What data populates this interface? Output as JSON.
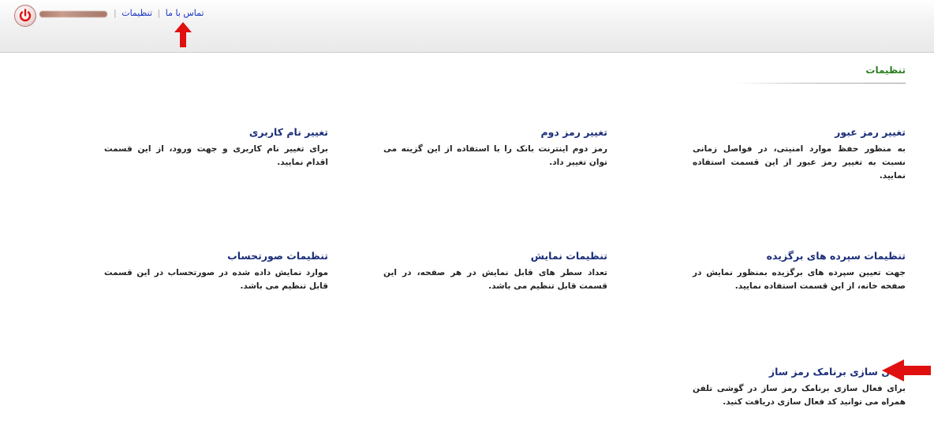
{
  "header": {
    "settings_link": "تنظیمات",
    "separator": "|",
    "contact_link": "تماس با ما",
    "separator2": "|"
  },
  "page": {
    "title": "تنظیمات"
  },
  "cards": [
    {
      "title": "تغییر رمز عبور",
      "desc": "به منظور حفظ موارد امنیتی، در فواصل زمانی نسبت به تغییر رمز عبور از این قسمت استفاده نمایید."
    },
    {
      "title": "تغییر رمز دوم",
      "desc": "رمز دوم اینترنت بانک را با استفاده از این گزینه می توان تغییر داد."
    },
    {
      "title": "تغییر نام کاربری",
      "desc": "برای تغییر نام کاربری و جهت ورود، از این قسمت اقدام نمایید."
    },
    {
      "title": "تنظیمات سپرده های برگزیده",
      "desc": "جهت تعیین سپرده های برگزیده بمنظور نمایش در صفحه خانه، از این قسمت استفاده نمایید."
    },
    {
      "title": "تنظیمات نمایش",
      "desc": "تعداد سطر های قابل نمایش در هر صفحه، در این قسمت قابل تنظیم می باشد."
    },
    {
      "title": "تنظیمات صورتحساب",
      "desc": "موارد نمایش داده شده در صورتحساب در این قسمت قابل تنظیم می باشد."
    },
    {
      "title": "فعال سازی برنامک رمز ساز",
      "desc": "برای فعال سازی برنامک رمز ساز در گوشی تلفن همراه می توانید کد فعال سازی دریافت کنید."
    }
  ],
  "colors": {
    "link": "#1a33c4",
    "title_green": "#2b7d1f",
    "card_title": "#1b2e7a",
    "arrow_red": "#e01010"
  },
  "icons": {
    "power": "power-icon",
    "up_arrow": "red-up-arrow-icon",
    "left_arrow": "red-left-arrow-icon"
  }
}
